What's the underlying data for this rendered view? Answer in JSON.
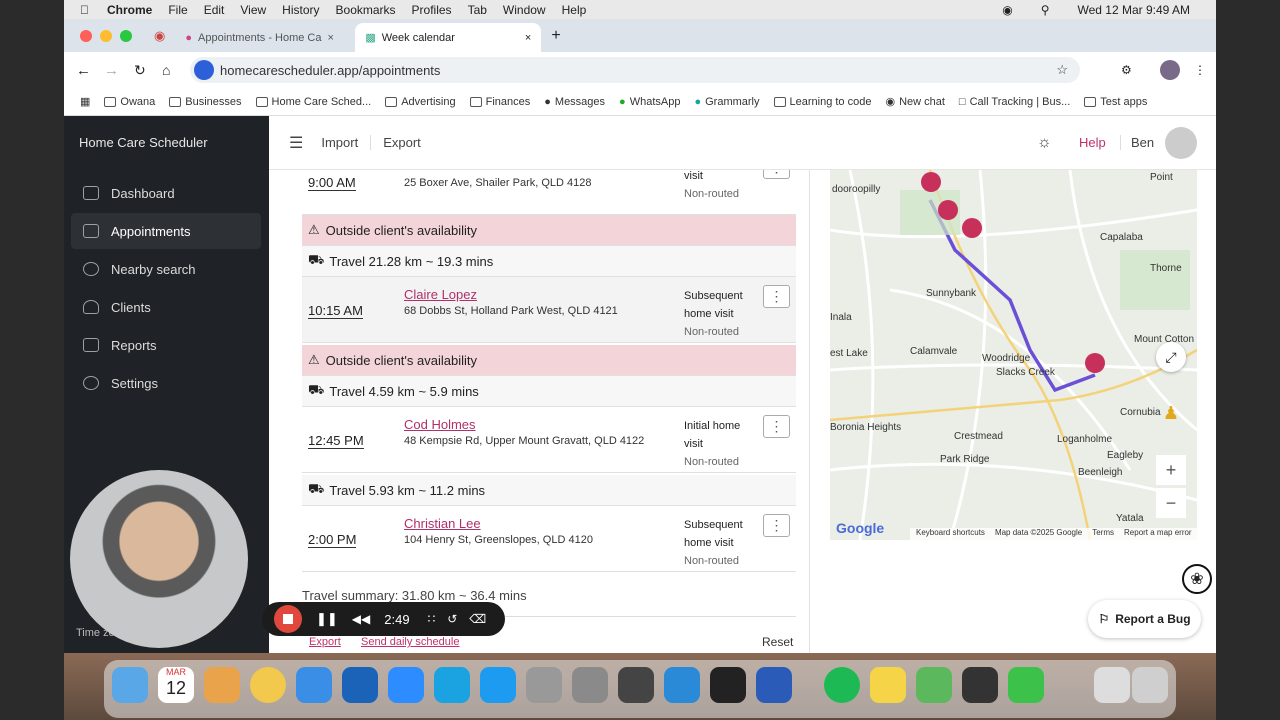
{
  "menubar": {
    "app": "Chrome",
    "items": [
      "File",
      "Edit",
      "View",
      "History",
      "Bookmarks",
      "Profiles",
      "Tab",
      "Window",
      "Help"
    ],
    "datetime": "Wed 12 Mar  9:49 AM"
  },
  "tabs": [
    {
      "title": "Appointments - Home Ca"
    },
    {
      "title": "Week calendar"
    }
  ],
  "address": {
    "url": "homecarescheduler.app/appointments"
  },
  "bookmarks": [
    "Owana",
    "Businesses",
    "Home Care Sched...",
    "Advertising",
    "Finances",
    "Messages",
    "WhatsApp",
    "Grammarly",
    "Learning to code",
    "New chat",
    "Call Tracking | Bus...",
    "Test apps"
  ],
  "sidebar": {
    "brand": "Home Care Scheduler",
    "items": [
      {
        "label": "Dashboard"
      },
      {
        "label": "Appointments"
      },
      {
        "label": "Nearby search"
      },
      {
        "label": "Clients"
      },
      {
        "label": "Reports"
      },
      {
        "label": "Settings"
      }
    ],
    "timezone": "Time zo"
  },
  "header": {
    "import": "Import",
    "export": "Export",
    "help": "Help",
    "user": "Ben"
  },
  "schedule": {
    "first": {
      "time": "9:00 AM",
      "address": "25 Boxer Ave, Shailer Park, QLD 4128",
      "type": "visit",
      "status": "Non-routed"
    },
    "alert1": "Outside client's availability",
    "travel1": "Travel 21.28 km ~ 19.3 mins",
    "appt2": {
      "time": "10:15 AM",
      "name": "Claire Lopez",
      "address": "68 Dobbs St, Holland Park West, QLD 4121",
      "type1": "Subsequent",
      "type2": "home visit",
      "status": "Non-routed"
    },
    "alert2": "Outside client's availability",
    "travel2": "Travel 4.59 km ~ 5.9 mins",
    "appt3": {
      "time": "12:45 PM",
      "name": "Cod Holmes",
      "address": "48 Kempsie Rd, Upper Mount Gravatt, QLD 4122",
      "type1": "Initial home",
      "type2": "visit",
      "status": "Non-routed"
    },
    "travel3": "Travel 5.93 km ~ 11.2 mins",
    "appt4": {
      "time": "2:00 PM",
      "name": "Christian Lee",
      "address": "104 Henry St, Greenslopes, QLD 4120",
      "type1": "Subsequent",
      "type2": "home visit",
      "status": "Non-routed"
    },
    "summary": "Travel summary: 31.80 km ~ 36.4 mins",
    "export_link": "Export",
    "send_link": "Send daily schedule",
    "reset": "Reset"
  },
  "map": {
    "labels": [
      "dooroopilly",
      "Point",
      "Capalaba",
      "Thorne",
      "Sunnybank",
      "Inala",
      "Mount Cotton",
      "est Lake",
      "Calamvale",
      "Woodridge",
      "Slacks Creek",
      "Cornubia",
      "Boronia Heights",
      "Crestmead",
      "Loganholme",
      "Eagleby",
      "Park Ridge",
      "Beenleigh",
      "Yatala"
    ],
    "footer": [
      "Keyboard shortcuts",
      "Map data ©2025 Google",
      "Terms",
      "Report a map error"
    ],
    "logo": "Google"
  },
  "recorder": {
    "time": "2:49"
  },
  "bug_button": "Report a Bug",
  "dock_date": {
    "month": "MAR",
    "day": "12"
  }
}
